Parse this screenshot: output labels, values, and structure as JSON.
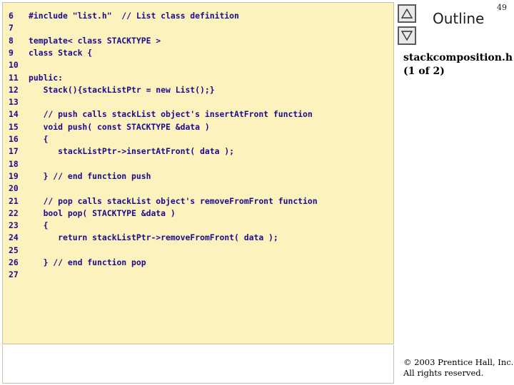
{
  "slide_number": "49",
  "outline": {
    "label": "Outline",
    "up_icon": "triangle-up-icon",
    "down_icon": "triangle-down-icon"
  },
  "file_title": {
    "name": "stackcomposition.h",
    "part": "(1 of 2)"
  },
  "code_lines": [
    {
      "no": "6",
      "code": "#include \"list.h\"  // List class definition"
    },
    {
      "no": "7",
      "code": ""
    },
    {
      "no": "8",
      "code": "template< class STACKTYPE >"
    },
    {
      "no": "9",
      "code": "class Stack {"
    },
    {
      "no": "10",
      "code": ""
    },
    {
      "no": "11",
      "code": "public:"
    },
    {
      "no": "12",
      "code": "   Stack(){stackListPtr = new List();}"
    },
    {
      "no": "13",
      "code": ""
    },
    {
      "no": "14",
      "code": "   // push calls stackList object's insertAtFront function"
    },
    {
      "no": "15",
      "code": "   void push( const STACKTYPE &data )"
    },
    {
      "no": "16",
      "code": "   {"
    },
    {
      "no": "17",
      "code": "      stackListPtr->insertAtFront( data );"
    },
    {
      "no": "18",
      "code": ""
    },
    {
      "no": "19",
      "code": "   } // end function push"
    },
    {
      "no": "20",
      "code": ""
    },
    {
      "no": "21",
      "code": "   // pop calls stackList object's removeFromFront function"
    },
    {
      "no": "22",
      "code": "   bool pop( STACKTYPE &data )"
    },
    {
      "no": "23",
      "code": "   {"
    },
    {
      "no": "24",
      "code": "      return stackListPtr->removeFromFront( data );"
    },
    {
      "no": "25",
      "code": ""
    },
    {
      "no": "26",
      "code": "   } // end function pop"
    },
    {
      "no": "27",
      "code": ""
    }
  ],
  "copyright": {
    "line1": "© 2003 Prentice Hall, Inc.",
    "line2": "All rights reserved."
  },
  "colors": {
    "code_background": "#fcf2bd",
    "code_text": "#1e0a8c"
  }
}
